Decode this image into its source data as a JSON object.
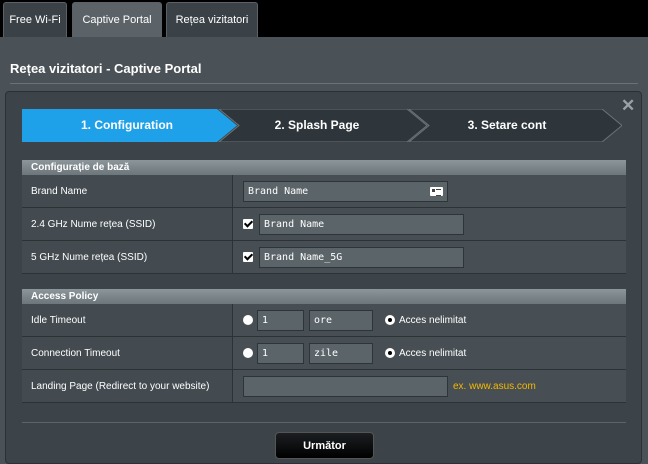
{
  "tabs": [
    {
      "label": "Free Wi-Fi"
    },
    {
      "label": "Captive Portal"
    },
    {
      "label": "Rețea vizitatori"
    }
  ],
  "panel": {
    "title": "Rețea vizitatori - Captive Portal"
  },
  "wizard": {
    "steps": [
      {
        "label": "1. Configuration",
        "active": true
      },
      {
        "label": "2. Splash Page",
        "active": false
      },
      {
        "label": "3. Setare cont",
        "active": false
      }
    ],
    "close_symbol": "✕"
  },
  "basic": {
    "header": "Configurație de bază",
    "brand_name": {
      "label": "Brand Name",
      "value": "Brand Name"
    },
    "ssid_24": {
      "label": "2.4 GHz Nume rețea (SSID)",
      "value": "Brand Name",
      "checked": true
    },
    "ssid_5": {
      "label": "5 GHz Nume rețea (SSID)",
      "value": "Brand Name_5G",
      "checked": true
    }
  },
  "policy": {
    "header": "Access Policy",
    "idle": {
      "label": "Idle Timeout",
      "value": "1",
      "unit": "ore",
      "unlimited_label": "Acces nelimitat"
    },
    "connection": {
      "label": "Connection Timeout",
      "value": "1",
      "unit": "zile",
      "unlimited_label": "Acces nelimitat"
    },
    "landing": {
      "label": "Landing Page (Redirect to your website)",
      "value": "",
      "hint": "ex. www.asus.com"
    }
  },
  "actions": {
    "next_label": "Următor"
  },
  "colors": {
    "accent": "#1ea1e8",
    "hint": "#f5b800"
  }
}
